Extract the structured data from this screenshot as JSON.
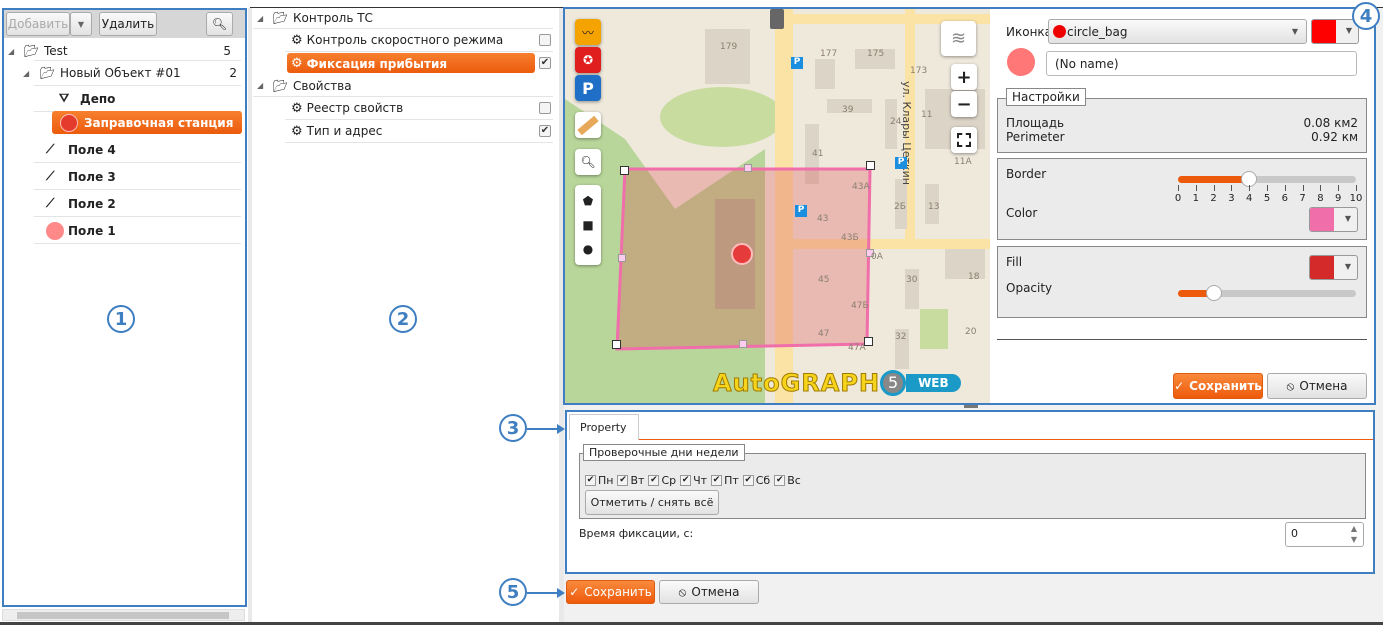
{
  "left_panel": {
    "add_label": "Добавить",
    "delete_label": "Удалить",
    "tree": [
      {
        "label": "Test",
        "count": "5",
        "icon": "folder-icon"
      },
      {
        "label": "Новый Объект #01",
        "count": "2",
        "icon": "folder-icon"
      },
      {
        "label": "Депо",
        "icon": "depot-icon"
      },
      {
        "label": "Заправочная станция",
        "icon": "circle-bag-icon",
        "selected": true
      },
      {
        "label": "Поле 4",
        "icon": "track-icon"
      },
      {
        "label": "Поле 3",
        "icon": "track-icon"
      },
      {
        "label": "Поле 2",
        "icon": "track-icon"
      },
      {
        "label": "Поле 1",
        "icon": "circle-bag-icon"
      }
    ]
  },
  "middle_panel": {
    "tree": [
      {
        "label": "Контроль ТС",
        "type": "folder"
      },
      {
        "label": "Контроль скоростного режима",
        "checked": false
      },
      {
        "label": "Фиксация прибытия",
        "checked": true,
        "selected": true
      },
      {
        "label": "Свойства",
        "type": "folder"
      },
      {
        "label": "Реестр свойств",
        "checked": false
      },
      {
        "label": "Тип и адрес",
        "checked": true
      }
    ]
  },
  "map": {
    "street": "ул. Клары Цеткин",
    "house_numbers": [
      "179",
      "177",
      "175",
      "173",
      "39",
      "24",
      "11",
      "41",
      "11А",
      "43А",
      "2Б",
      "13",
      "43",
      "43Б",
      "0А",
      "45",
      "30",
      "18",
      "47Б",
      "47",
      "47А",
      "32",
      "20"
    ],
    "logo": "AutoGRAPH",
    "logo_version": "5",
    "logo_web": "WEB",
    "zone_color": "#f06eaa"
  },
  "props": {
    "icon_label": "Иконка",
    "icon_value": "circle_bag",
    "icon_color": "#ff0000",
    "name_value": "(No name)",
    "settings_legend": "Настройки",
    "area_label": "Площадь",
    "area_value": "0.08 км2",
    "perimeter_label": "Perimeter",
    "perimeter_value": "0.92 км",
    "border_label": "Border",
    "border_value": 4,
    "border_ticks": [
      "0",
      "1",
      "2",
      "3",
      "4",
      "5",
      "6",
      "7",
      "8",
      "9",
      "10"
    ],
    "color_label": "Color",
    "border_color": "#f06eaa",
    "fill_label": "Fill",
    "fill_color": "#d42a2a",
    "opacity_label": "Opacity",
    "opacity_percent": 20,
    "save_label": "Сохранить",
    "cancel_label": "Отмена"
  },
  "property_panel": {
    "tab": "Property",
    "days_legend": "Проверочные дни недели",
    "days": [
      "Пн",
      "Вт",
      "Ср",
      "Чт",
      "Пт",
      "Сб",
      "Вс"
    ],
    "toggle_all": "Отметить / снять всё",
    "time_label": "Время фиксации, с:",
    "time_value": "0"
  },
  "footer": {
    "save_label": "Сохранить",
    "cancel_label": "Отмена"
  },
  "callouts": [
    "1",
    "2",
    "3",
    "4",
    "5"
  ],
  "accent_color": "#ee5a0c",
  "callout_color": "#3f7fc1"
}
